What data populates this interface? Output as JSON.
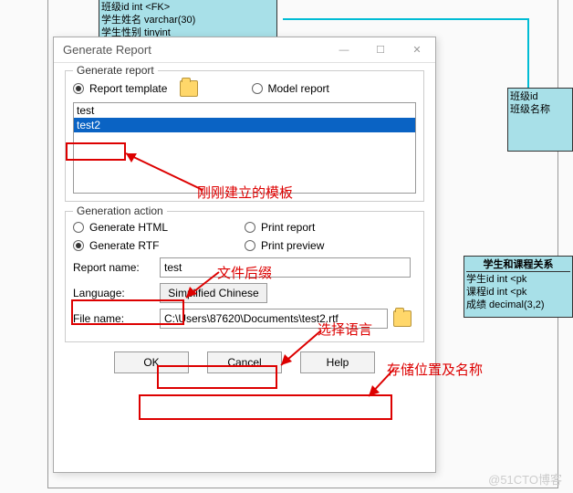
{
  "bg": {
    "db1_rows": [
      "班级id            int                       <FK>",
      "学生姓名          varchar(30)",
      "学生性别          tinyint"
    ],
    "db2_rows": [
      "班级id",
      "班级名称"
    ],
    "db3_title": "学生和课程关系",
    "db3_rows": [
      "学生id    int           <pk",
      "课程id    int           <pk",
      "成绩      decimal(3,2)"
    ]
  },
  "dialog": {
    "title": "Generate Report",
    "group1": {
      "legend": "Generate report",
      "opt_template": "Report template",
      "opt_model": "Model report",
      "items": [
        "test",
        "test2"
      ],
      "selected": 1
    },
    "group2": {
      "legend": "Generation action",
      "opt_html": "Generate HTML",
      "opt_rtf": "Generate RTF",
      "opt_print_report": "Print report",
      "opt_print_preview": "Print preview",
      "lbl_report_name": "Report name:",
      "val_report_name": "test",
      "lbl_language": "Language:",
      "val_language": "Simplified Chinese",
      "lbl_file_name": "File name:",
      "val_file_name": "C:\\Users\\87620\\Documents\\test2.rtf"
    },
    "buttons": {
      "ok": "OK",
      "cancel": "Cancel",
      "help": "Help"
    }
  },
  "anno": {
    "a1": "刚刚建立的模板",
    "a2": "文件后缀",
    "a3": "选择语言",
    "a4": "存储位置及名称"
  },
  "watermark": "@51CTO博客"
}
